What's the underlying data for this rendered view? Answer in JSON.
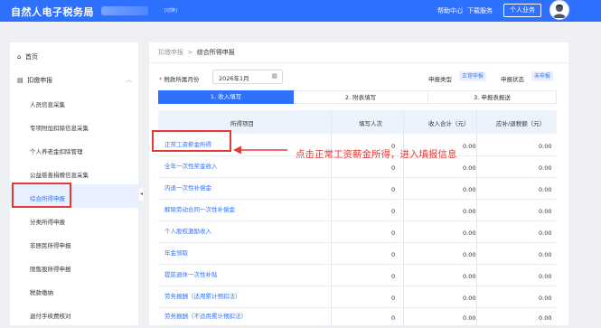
{
  "header": {
    "title": "自然人电子税务局",
    "switch_label": "[切换]",
    "help": "帮助中心",
    "separator": "|",
    "download": "下载服务",
    "user_button": "个人业务",
    "brand_color": "#2f71ff"
  },
  "sidebar": {
    "home": "首页",
    "group": "扣缴申报",
    "items": [
      "人员信息采集",
      "专项附加扣除信息采集",
      "个人养老金扣除管理",
      "公益慈善捐赠信息采集",
      "综合所得申报",
      "分类所得申报",
      "非居民所得申报",
      "限售股所得申报",
      "税款缴纳",
      "退付手续费核对"
    ],
    "active_index": 4
  },
  "main": {
    "breadcrumb": [
      "扣缴申报",
      "综合所得申报"
    ],
    "breadcrumb_sep": ">",
    "period_required_mark": "*",
    "period_label": "税款所属月份",
    "period_value": "2026年1月",
    "type_label": "申报类型",
    "type_value": "正常申报",
    "status_label": "申报状态",
    "status_value": "未申报",
    "steps": [
      "1. 收入填写",
      "2. 附表填写",
      "3. 申报表报送"
    ],
    "columns": [
      "所得项目",
      "填写人次",
      "收入合计（元）",
      "应补/退税额（元）"
    ],
    "rows": [
      {
        "name": "正常工资薪金所得",
        "count": "0",
        "income": "0.00",
        "tax": "0.00"
      },
      {
        "name": "全年一次性奖金收入",
        "count": "0",
        "income": "0.00",
        "tax": "0.00"
      },
      {
        "name": "内退一次性补偿金",
        "count": "0",
        "income": "0.00",
        "tax": "0.00"
      },
      {
        "name": "解除劳动合同一次性补偿金",
        "count": "0",
        "income": "0.00",
        "tax": "0.00"
      },
      {
        "name": "个人股权激励收入",
        "count": "0",
        "income": "0.00",
        "tax": "0.00"
      },
      {
        "name": "年金领取",
        "count": "0",
        "income": "0.00",
        "tax": "0.00"
      },
      {
        "name": "提前退休一次性补贴",
        "count": "0",
        "income": "0.00",
        "tax": "0.00"
      },
      {
        "name": "劳务报酬（适用累计预扣法）",
        "count": "0",
        "income": "0.00",
        "tax": "0.00"
      },
      {
        "name": "劳务报酬（不适用累计预扣法）",
        "count": "0",
        "income": "0.00",
        "tax": "0.00"
      }
    ]
  },
  "annotation": {
    "text": "点击正常工资薪金所得，进入填报信息",
    "color": "#e53935"
  }
}
